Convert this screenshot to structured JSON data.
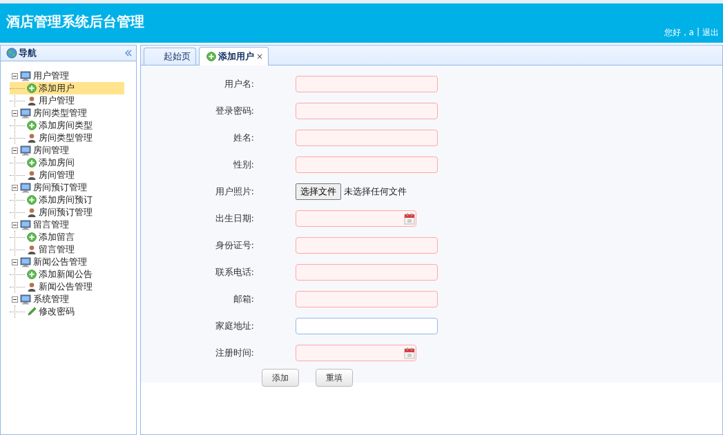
{
  "header": {
    "title": "酒店管理系统后台管理",
    "greeting": "您好，a",
    "separator": "|",
    "logout": "退出"
  },
  "nav": {
    "title": "导航",
    "groups": [
      {
        "label": "用户管理",
        "expanded": true,
        "children": [
          {
            "label": "添加用户",
            "kind": "add",
            "selected": true
          },
          {
            "label": "用户管理",
            "kind": "manage",
            "selected": false
          }
        ]
      },
      {
        "label": "房间类型管理",
        "expanded": true,
        "children": [
          {
            "label": "添加房间类型",
            "kind": "add",
            "selected": false
          },
          {
            "label": "房间类型管理",
            "kind": "manage",
            "selected": false
          }
        ]
      },
      {
        "label": "房间管理",
        "expanded": true,
        "children": [
          {
            "label": "添加房间",
            "kind": "add",
            "selected": false
          },
          {
            "label": "房间管理",
            "kind": "manage",
            "selected": false
          }
        ]
      },
      {
        "label": "房间预订管理",
        "expanded": true,
        "children": [
          {
            "label": "添加房间预订",
            "kind": "add",
            "selected": false
          },
          {
            "label": "房间预订管理",
            "kind": "manage",
            "selected": false
          }
        ]
      },
      {
        "label": "留言管理",
        "expanded": true,
        "children": [
          {
            "label": "添加留言",
            "kind": "add",
            "selected": false
          },
          {
            "label": "留言管理",
            "kind": "manage",
            "selected": false
          }
        ]
      },
      {
        "label": "新闻公告管理",
        "expanded": true,
        "children": [
          {
            "label": "添加新闻公告",
            "kind": "add",
            "selected": false
          },
          {
            "label": "新闻公告管理",
            "kind": "manage",
            "selected": false
          }
        ]
      },
      {
        "label": "系统管理",
        "expanded": true,
        "children": [
          {
            "label": "修改密码",
            "kind": "edit",
            "selected": false
          }
        ]
      }
    ]
  },
  "tabs": [
    {
      "label": "起始页",
      "selected": false,
      "closable": false
    },
    {
      "label": "添加用户",
      "selected": true,
      "closable": true,
      "close": "×"
    }
  ],
  "form": {
    "fields": [
      {
        "label": "用户名:",
        "kind": "text",
        "invalid": true
      },
      {
        "label": "登录密码:",
        "kind": "text",
        "invalid": true
      },
      {
        "label": "姓名:",
        "kind": "text",
        "invalid": true
      },
      {
        "label": "性别:",
        "kind": "text",
        "invalid": true
      },
      {
        "label": "用户照片:",
        "kind": "file",
        "button": "选择文件",
        "status": "未选择任何文件"
      },
      {
        "label": "出生日期:",
        "kind": "date",
        "invalid": true
      },
      {
        "label": "身份证号:",
        "kind": "text",
        "invalid": true
      },
      {
        "label": "联系电话:",
        "kind": "text",
        "invalid": true
      },
      {
        "label": "邮箱:",
        "kind": "text",
        "invalid": true
      },
      {
        "label": "家庭地址:",
        "kind": "text",
        "invalid": false
      },
      {
        "label": "注册时间:",
        "kind": "date",
        "invalid": true
      }
    ],
    "buttons": [
      "添加",
      "重填"
    ]
  }
}
